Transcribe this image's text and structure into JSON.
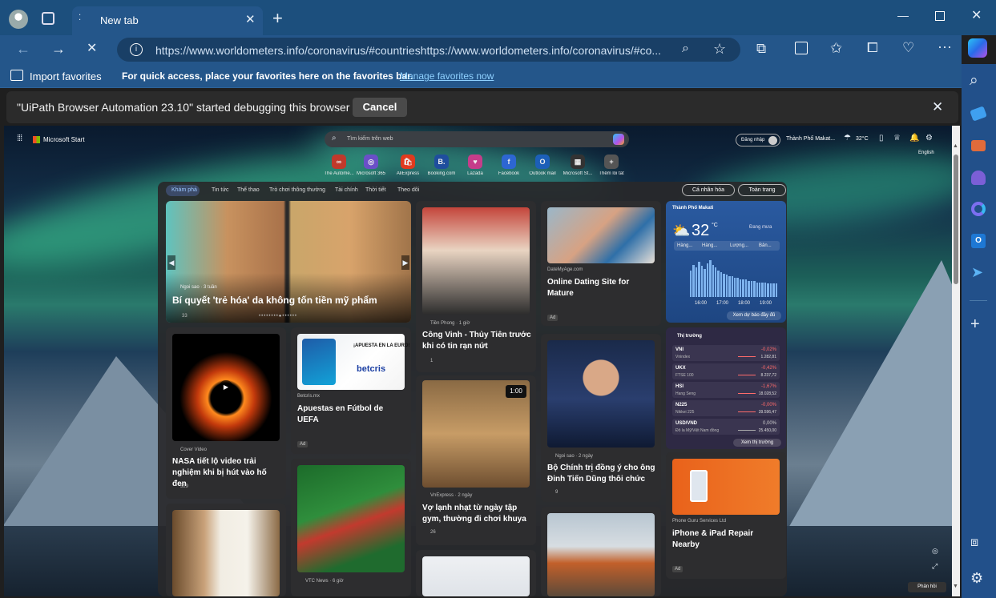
{
  "browser": {
    "tab_title": "New tab",
    "url": "https://www.worldometers.info/coronavirus/#countrieshttps://www.worldometers.info/coronavirus/#co...",
    "import_favorites": "Import favorites",
    "favorites_prompt": "For quick access, place your favorites here on the favorites bar.",
    "manage_favorites": "Manage favorites now",
    "infobar_message": "\"UiPath Browser Automation 23.10\" started debugging this browser",
    "cancel_label": "Cancel"
  },
  "start": {
    "brand": "Microsoft Start",
    "search_placeholder": "Tìm kiếm trên web",
    "signin": "Đăng nhập",
    "location": "Thành Phố Makat...",
    "temp": "32°C",
    "language": "English",
    "quick_links": [
      {
        "label": "The Autome...",
        "glyph": "∞",
        "color": "#c0392b"
      },
      {
        "label": "Microsoft 365",
        "glyph": "◎",
        "color": "#6a4fc7"
      },
      {
        "label": "AliExpress",
        "glyph": "🛍",
        "color": "#e03a1e"
      },
      {
        "label": "Booking.com",
        "glyph": "B.",
        "color": "#1f4e9e"
      },
      {
        "label": "Lazada",
        "glyph": "♥",
        "color": "#c53d8a"
      },
      {
        "label": "Facebook",
        "glyph": "f",
        "color": "#2d66d2"
      },
      {
        "label": "Outlook mail",
        "glyph": "O",
        "color": "#1c5fb8"
      },
      {
        "label": "Microsoft St...",
        "glyph": "▦",
        "color": "#333333"
      },
      {
        "label": "Thêm lối tắt",
        "glyph": "+",
        "color": "#555555"
      }
    ],
    "nav_tabs": [
      "Khám phá",
      "Tin tức",
      "Thể thao",
      "Trò chơi thông thường",
      "Tài chính",
      "Thời tiết",
      "Theo dõi"
    ],
    "personalize": "Cá nhân hóa",
    "full_page": "Toàn trang",
    "feedback": "Phản hồi"
  },
  "cards": {
    "hero": {
      "source": "Ngoi sao · 3 tuần",
      "title": "Bí quyết 'trẻ hóa' da không tốn tiền mỹ phẩm",
      "likes": "33"
    },
    "tienphong": {
      "source": "Tiền Phong · 1 giờ",
      "title": "Công Vinh - Thủy Tiên trước khi có tin rạn nứt",
      "likes": "1"
    },
    "dating": {
      "source": "DateMyAge.com",
      "title": "Online Dating Site for Mature",
      "ad": "Ad"
    },
    "weather": {
      "city": "Thành Phố Makati",
      "temp": "32",
      "unit": "°C",
      "rain": "Đang mưa",
      "tabs": [
        "Hàng...",
        "Hàng...",
        "Lượng...",
        "Bản..."
      ],
      "hours": [
        "16:00",
        "17:00",
        "18:00",
        "19:00"
      ],
      "rain_bars": [
        18,
        22,
        20,
        24,
        21,
        19,
        23,
        25,
        22,
        20,
        18,
        17,
        16,
        15,
        14,
        14,
        13,
        13,
        12,
        12,
        12,
        11,
        11,
        11,
        10,
        10,
        10,
        10,
        9,
        9,
        9,
        9
      ],
      "button": "Xem dự báo đầy đủ"
    },
    "nasa": {
      "source": "Cover Video",
      "title": "NASA tiết lộ video trải nghiệm khi bị hút vào hố đen",
      "likes": "329"
    },
    "betcris": {
      "banner": "¡APUESTA EN LA EURO!",
      "brand": "betcris",
      "source": "Betcris.mx",
      "title": "Apuestas en Fútbol de UEFA",
      "ad": "Ad"
    },
    "anime": {
      "clock": "1:00",
      "source": "VnExpress · 2 ngày",
      "title": "Vợ lạnh nhạt từ ngày tập gym, thường đi chơi khuya",
      "likes": "26"
    },
    "politics": {
      "source": "Ngoi sao · 2 ngày",
      "title": "Bộ Chính trị đồng ý cho ông Đinh Tiến Dũng thôi chức",
      "likes": "9"
    },
    "market": {
      "title": "Thị trường",
      "rows": [
        {
          "sym": "VNI",
          "name": "Vnindex",
          "chg": "-0,02%",
          "val": "1.282,81"
        },
        {
          "sym": "UKX",
          "name": "FTSE 100",
          "chg": "-0,42%",
          "val": "8.237,72"
        },
        {
          "sym": "HSI",
          "name": "Hang Seng",
          "chg": "-1,67%",
          "val": "18.028,52"
        },
        {
          "sym": "N225",
          "name": "Nikkei 225",
          "chg": "-0,00%",
          "val": "39.596,47"
        },
        {
          "sym": "USD/VND",
          "name": "Đô la Mỹ/Việt Nam đồng",
          "chg": "0,00%",
          "val": "25.450,00"
        }
      ],
      "button": "Xem thị trường"
    },
    "vtc": {
      "source": "VTC News · 6 giờ"
    },
    "phone": {
      "source": "Phone Guru Services Ltd",
      "title": "iPhone & iPad Repair Nearby",
      "ad": "Ad"
    }
  }
}
